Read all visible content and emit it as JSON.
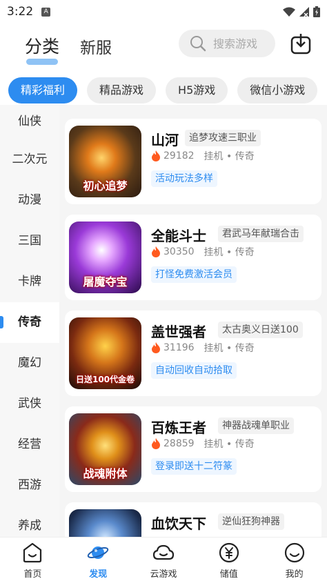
{
  "status": {
    "time": "3:22",
    "notif_letter": "A"
  },
  "header": {
    "tabs": [
      {
        "label": "分类"
      },
      {
        "label": "新服"
      }
    ],
    "search_placeholder": "搜索游戏"
  },
  "chips": [
    {
      "label": "精彩福利"
    },
    {
      "label": "精品游戏"
    },
    {
      "label": "H5游戏"
    },
    {
      "label": "微信小游戏"
    }
  ],
  "genres": [
    {
      "label": "仙侠"
    },
    {
      "label": "二次元"
    },
    {
      "label": "动漫"
    },
    {
      "label": "三国"
    },
    {
      "label": "卡牌"
    },
    {
      "label": "传奇"
    },
    {
      "label": "魔幻"
    },
    {
      "label": "武侠"
    },
    {
      "label": "经营"
    },
    {
      "label": "西游"
    },
    {
      "label": "养成"
    }
  ],
  "games": [
    {
      "name": "山河",
      "tag": "追梦攻速三职业",
      "players": "29182",
      "category": "挂机 • 传奇",
      "promo": "活动玩法多样",
      "icon_text": "初心追梦"
    },
    {
      "name": "全能斗士",
      "tag": "君武马年献瑞合击",
      "players": "30350",
      "category": "挂机 • 传奇",
      "promo": "打怪免费激活会员",
      "icon_text": "屠魔夺宝"
    },
    {
      "name": "盖世强者",
      "tag": "太古奥义日送100",
      "players": "31196",
      "category": "挂机 • 传奇",
      "promo": "自动回收自动拾取",
      "icon_text": "日送100代金卷"
    },
    {
      "name": "百炼王者",
      "tag": "神器战魂单职业",
      "players": "28859",
      "category": "挂机 • 传奇",
      "promo": "登录即送十二符篆",
      "icon_text": "战魂附体"
    },
    {
      "name": "血饮天下",
      "tag": "逆仙狂狗神器",
      "players": "",
      "category": "",
      "promo": "",
      "icon_text": ""
    }
  ],
  "bottom_nav": [
    {
      "label": "首页"
    },
    {
      "label": "发现"
    },
    {
      "label": "云游戏"
    },
    {
      "label": "储值"
    },
    {
      "label": "我的"
    }
  ],
  "colors": {
    "accent": "#2d8cf0",
    "fire": "#ff5a1f"
  }
}
